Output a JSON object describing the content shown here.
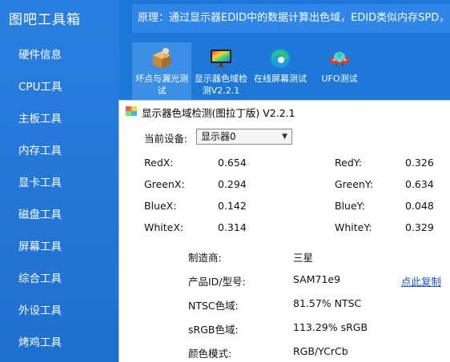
{
  "app": {
    "title": "图吧工具箱"
  },
  "sidebar": {
    "items": [
      {
        "label": "硬件信息"
      },
      {
        "label": "CPU工具"
      },
      {
        "label": "主板工具"
      },
      {
        "label": "内存工具"
      },
      {
        "label": "显卡工具"
      },
      {
        "label": "磁盘工具"
      },
      {
        "label": "屏幕工具"
      },
      {
        "label": "综合工具"
      },
      {
        "label": "外设工具"
      },
      {
        "label": "烤鸡工具"
      }
    ]
  },
  "banner": {
    "text": "原理：通过显示器EDID中的数据计算出色域，EDID类似内存SPD，可"
  },
  "tools": [
    {
      "line1": "坏点与漏光测",
      "line2": "试",
      "icon": "box-icon"
    },
    {
      "line1": "显示器色域检",
      "line2": "测V2.2.1",
      "icon": "monitor-icon"
    },
    {
      "line1": "在线屏幕测试",
      "line2": "",
      "icon": "edge-browser-icon"
    },
    {
      "line1": "UFO测试",
      "line2": "",
      "icon": "ufo-icon"
    }
  ],
  "window": {
    "title": "显示器色域检测(图拉丁版) V2.2.1",
    "device_label": "当前设备:",
    "device_value": "显示器0",
    "coords": {
      "red_x_label": "RedX:",
      "red_x": "0.654",
      "red_y_label": "RedY:",
      "red_y": "0.326",
      "green_x_label": "GreenX:",
      "green_x": "0.294",
      "green_y_label": "GreenY:",
      "green_y": "0.634",
      "blue_x_label": "BlueX:",
      "blue_x": "0.142",
      "blue_y_label": "BlueY:",
      "blue_y": "0.048",
      "white_x_label": "WhiteX:",
      "white_x": "0.314",
      "white_y_label": "WhiteY:",
      "white_y": "0.329"
    },
    "info": {
      "maker_label": "制造商:",
      "maker": "三星",
      "model_label": "产品ID/型号:",
      "model": "SAM71e9",
      "copy_link": "点此复制",
      "ntsc_label": "NTSC色域:",
      "ntsc": "81.57% NTSC",
      "srgb_label": "sRGB色域:",
      "srgb": "113.29% sRGB",
      "color_mode_label": "颜色模式:",
      "color_mode": "RGB/YCrCb"
    }
  }
}
